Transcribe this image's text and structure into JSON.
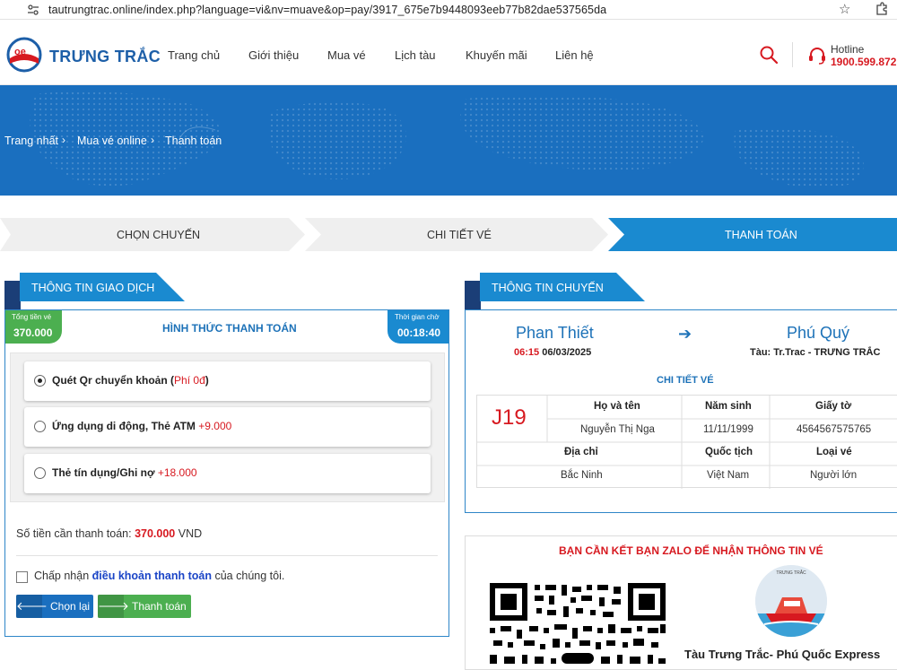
{
  "browser": {
    "url": "tautrungtrac.online/index.php?language=vi&nv=muave&op=pay/3917_675e7b9448093eeb77b82dae537565da"
  },
  "header": {
    "brand": "TRƯNG TRẮC",
    "nav": [
      "Trang chủ",
      "Giới thiệu",
      "Mua vé",
      "Lịch tàu",
      "Khuyến mãi",
      "Liên hệ"
    ],
    "hotline_label": "Hotline",
    "hotline_number": "1900.599.872"
  },
  "breadcrumb": [
    "Trang nhất",
    "Mua vé online",
    "Thanh toán"
  ],
  "steps": [
    {
      "label": "CHỌN CHUYẾN",
      "active": false
    },
    {
      "label": "CHI TIẾT VÉ",
      "active": false
    },
    {
      "label": "THANH TOÁN",
      "active": true
    }
  ],
  "transaction": {
    "tab_title": "THÔNG TIN GIAO DỊCH",
    "total_label": "Tổng tiền vé",
    "total_value": "370.000",
    "wait_label": "Thời gian chờ",
    "wait_value": "00:18:40",
    "method_title": "HÌNH THỨC THANH TOÁN",
    "options": [
      {
        "label": "Quét Qr chuyển khoản",
        "fee": "Phí 0đ",
        "selected": true
      },
      {
        "label": "Ứng dụng di động, Thẻ ATM",
        "fee": "+9.000",
        "selected": false
      },
      {
        "label": "Thẻ tín dụng/Ghi nợ",
        "fee": "+18.000",
        "selected": false
      }
    ],
    "amount_label": "Số tiền cần thanh toán:",
    "amount_value": "370.000",
    "amount_unit": "VND",
    "terms_prefix": "Chấp nhận",
    "terms_link": "điều khoản thanh toán",
    "terms_suffix": "của chúng tôi.",
    "back_button": "Chọn lại",
    "pay_button": "Thanh toán"
  },
  "trip": {
    "tab_title": "THÔNG TIN CHUYẾN",
    "from": "Phan Thiết",
    "to": "Phú Quý",
    "depart_time": "06:15",
    "depart_date": "06/03/2025",
    "ship": "Tàu: Tr.Trac - TRƯNG TRẮC",
    "detail_title": "CHI TIẾT VÉ",
    "seat": "J19",
    "headers_row1": [
      "Họ và tên",
      "Năm sinh",
      "Giấy tờ"
    ],
    "values_row1": [
      "Nguyễn Thị Nga",
      "11/11/1999",
      "4564567575765"
    ],
    "headers_row2": [
      "Địa chỉ",
      "Quốc tịch",
      "Loại vé"
    ],
    "values_row2": [
      "Bắc Ninh",
      "Việt Nam",
      "Người lớn"
    ]
  },
  "zalo": {
    "title": "BẠN CẦN KẾT BẠN ZALO ĐỂ NHẬN THÔNG TIN VÉ",
    "name": "Tàu Trưng Trắc- Phú Quốc Express"
  },
  "colors": {
    "primary": "#1d72b8",
    "banner": "#1a6fbf",
    "active_step": "#1a8ad0",
    "accent_red": "#d71920",
    "green": "#4caf50"
  }
}
